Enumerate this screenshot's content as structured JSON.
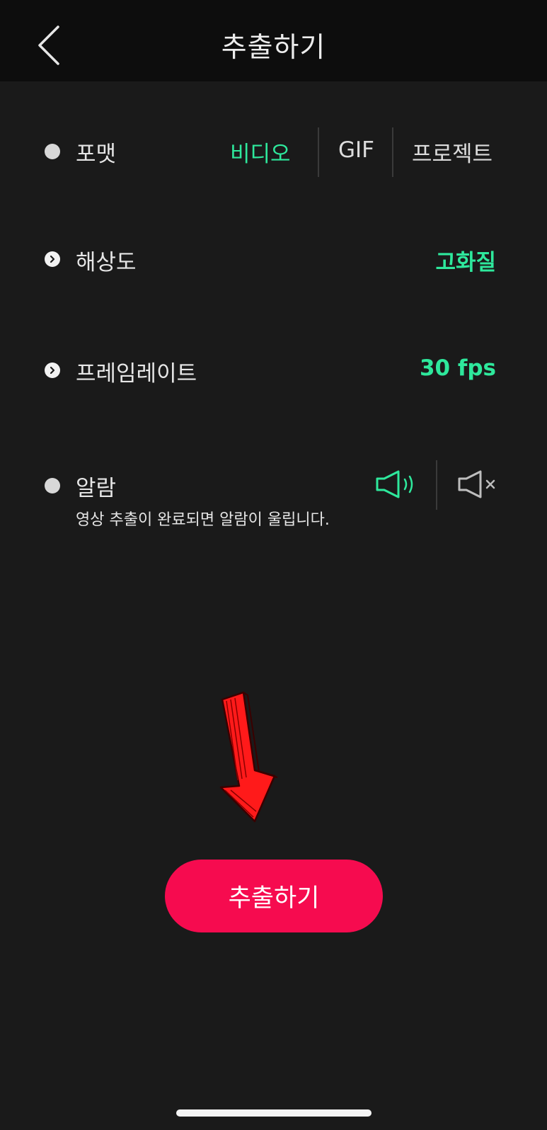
{
  "header": {
    "title": "추출하기"
  },
  "format": {
    "label": "포맷",
    "options": [
      "비디오",
      "GIF",
      "프로젝트"
    ],
    "selected": "비디오"
  },
  "resolution": {
    "label": "해상도",
    "value": "고화질"
  },
  "framerate": {
    "label": "프레임레이트",
    "value": "30 fps"
  },
  "alarm": {
    "label": "알람",
    "description": "영상 추출이 완료되면 알람이 울립니다.",
    "state": "sound-on"
  },
  "export_button": {
    "label": "추출하기"
  },
  "colors": {
    "accent": "#2ee89c",
    "export_button": "#f60b4f",
    "background": "#1a1a1a",
    "header": "#0d0d0d",
    "annotation_arrow": "#ff0000"
  },
  "icons": {
    "back": "chevron-left-icon",
    "expand": "chevron-right-icon",
    "sound_on": "speaker-on-icon",
    "sound_off": "speaker-mute-icon",
    "annotation": "red-arrow-down-icon"
  }
}
